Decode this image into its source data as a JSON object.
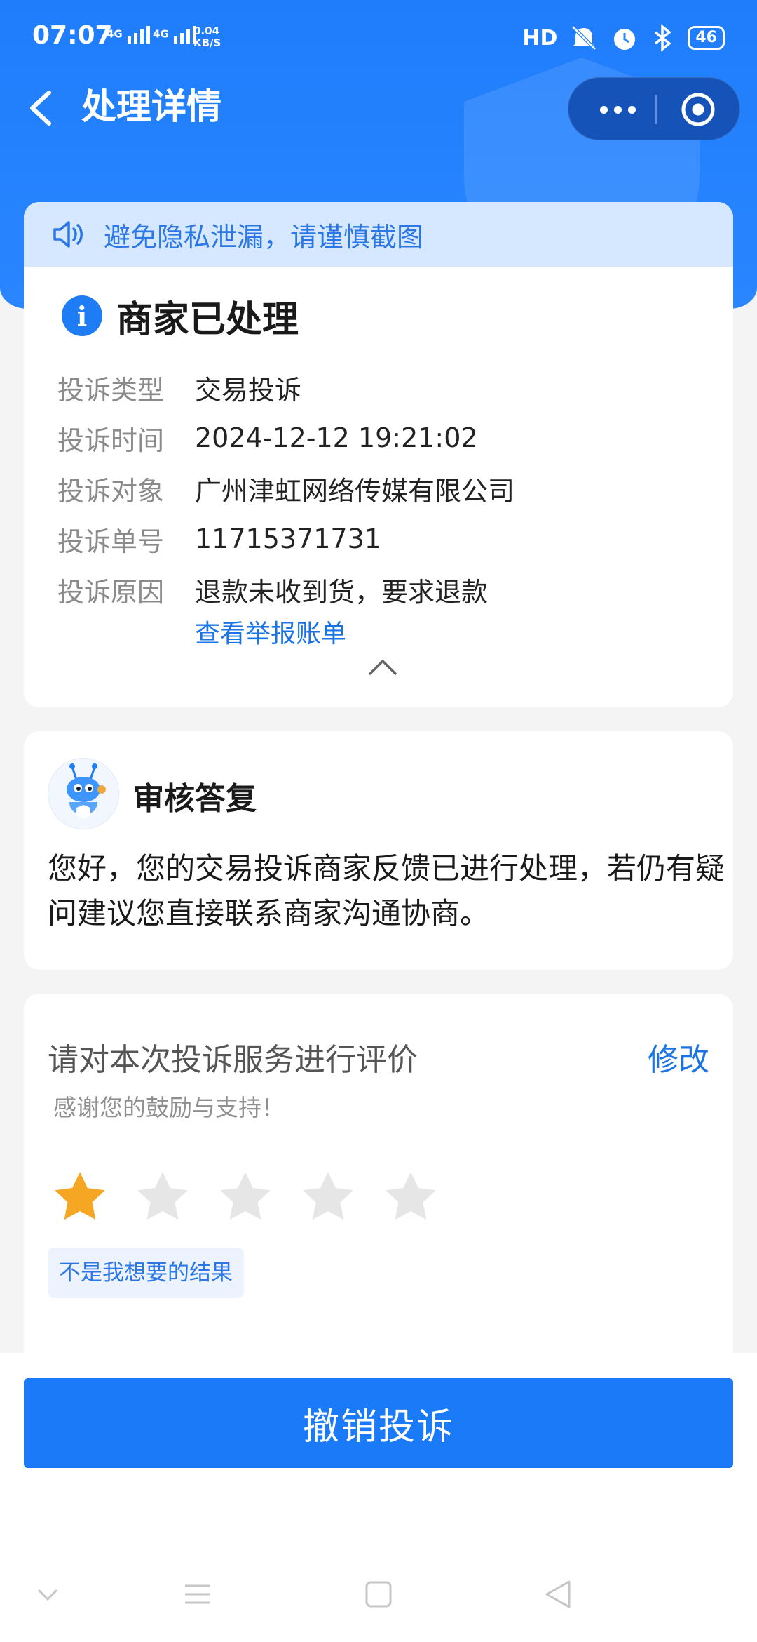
{
  "status_bar": {
    "time": "07:07",
    "signal_1": "4G",
    "signal_2": "4G",
    "net_speed_value": "0.04",
    "net_speed_unit": "KB/S",
    "hd_label": "HD",
    "battery": "46"
  },
  "nav": {
    "title": "处理详情"
  },
  "notice": {
    "text": "避免隐私泄漏，请谨慎截图"
  },
  "complaint": {
    "status": "商家已处理",
    "fields": [
      {
        "label": "投诉类型",
        "value": "交易投诉"
      },
      {
        "label": "投诉时间",
        "value": "2024-12-12 19:21:02"
      },
      {
        "label": "投诉对象",
        "value": "广州津虹网络传媒有限公司"
      },
      {
        "label": "投诉单号",
        "value": "11715371731"
      },
      {
        "label": "投诉原因",
        "value": "退款未收到货，要求退款"
      }
    ],
    "view_bill_link": "查看举报账单"
  },
  "review_reply": {
    "title": "审核答复",
    "text": "您好，您的交易投诉商家反馈已进行处理，若仍有疑问建议您直接联系商家沟通协商。"
  },
  "rating": {
    "title": "请对本次投诉服务进行评价",
    "edit_label": "修改",
    "subtitle": "感谢您的鼓励与支持！",
    "stars_total": 5,
    "stars_selected": 1,
    "tag": "不是我想要的结果"
  },
  "actions": {
    "cancel_complaint": "撤销投诉"
  },
  "colors": {
    "brand_blue": "#1f7dfc",
    "link_blue": "#1b74e4",
    "star_active": "#f5a623",
    "star_inactive": "#e6e6e6"
  },
  "icons": [
    "back-icon",
    "more-icon",
    "close-target-icon",
    "speaker-icon",
    "info-icon",
    "chevron-up-icon",
    "star-icon"
  ]
}
